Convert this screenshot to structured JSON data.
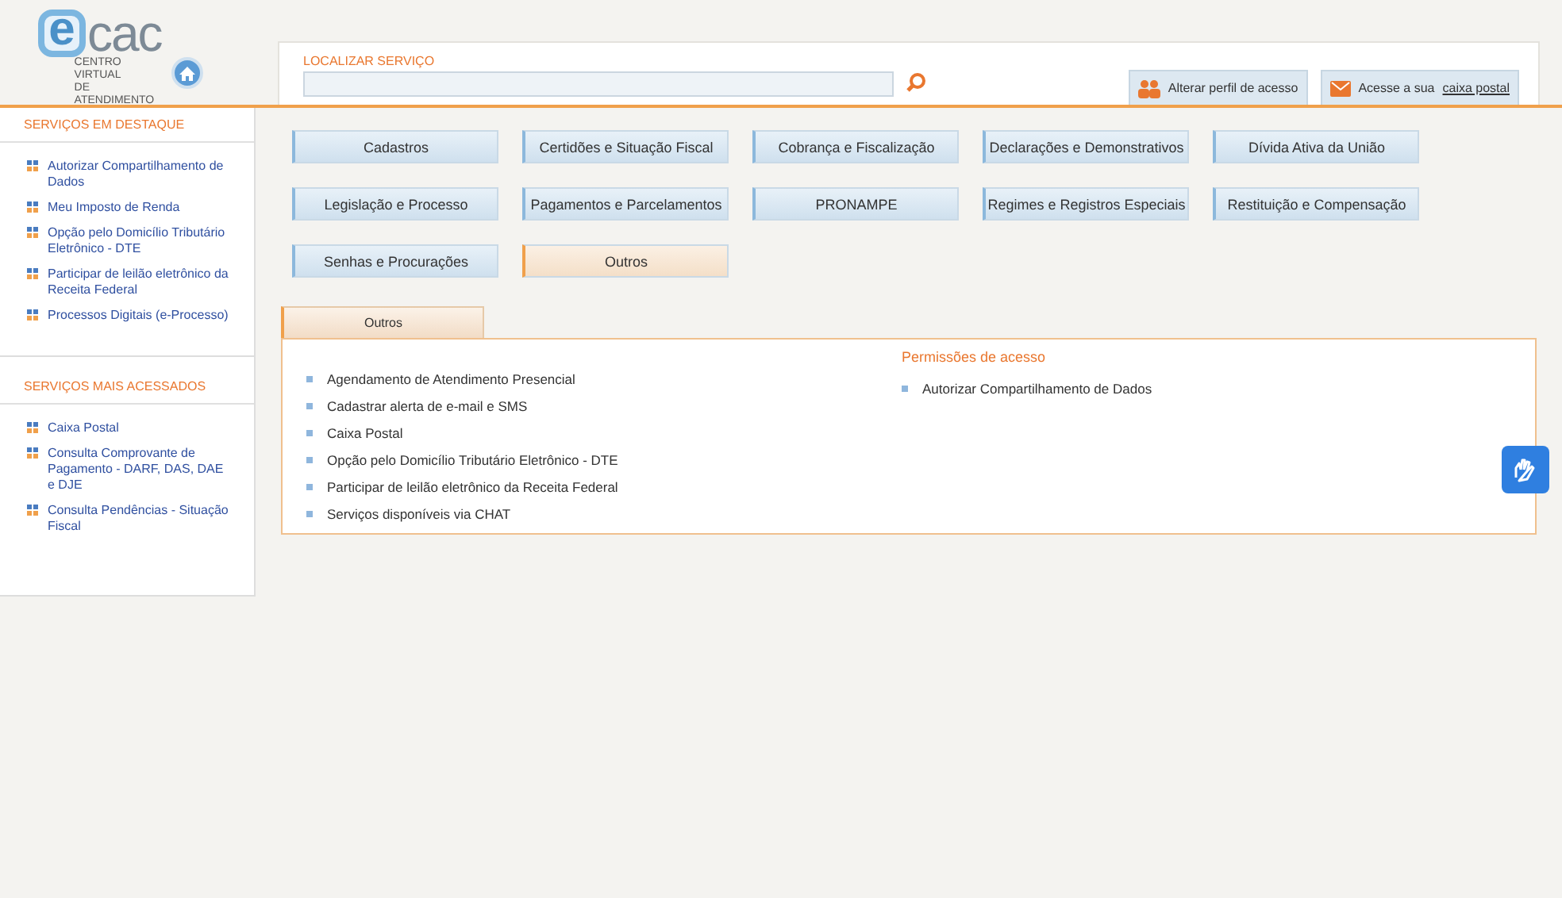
{
  "logo": {
    "mark": "e",
    "name": "cac",
    "subtitle_lines": [
      "CENTRO VIRTUAL",
      "DE ATENDIMENTO"
    ]
  },
  "search": {
    "label": "LOCALIZAR SERVIÇO"
  },
  "header_buttons": [
    {
      "kind": "profile",
      "text": "Alterar perfil de acesso"
    },
    {
      "kind": "mail",
      "text": "Acesse a sua",
      "link": "caixa postal"
    }
  ],
  "sidebar": [
    {
      "title": "SERVIÇOS EM DESTAQUE",
      "items": [
        "Autorizar Compartilhamento de Dados",
        "Meu Imposto de Renda",
        "Opção pelo Domicílio Tributário Eletrônico - DTE",
        "Participar de leilão eletrônico da Receita Federal",
        "Processos Digitais (e-Processo)"
      ]
    },
    {
      "title": "SERVIÇOS MAIS ACESSADOS",
      "items": [
        "Caixa Postal",
        "Consulta Comprovante de Pagamento - DARF, DAS, DAE e DJE",
        "Consulta Pendências - Situação Fiscal"
      ]
    }
  ],
  "categories": [
    {
      "label": "Cadastros",
      "selected": false
    },
    {
      "label": "Certidões e Situação Fiscal",
      "selected": false
    },
    {
      "label": "Cobrança e Fiscalização",
      "selected": false
    },
    {
      "label": "Declarações e Demonstrativos",
      "selected": false
    },
    {
      "label": "Dívida Ativa da União",
      "selected": false
    },
    {
      "label": "Legislação e Processo",
      "selected": false
    },
    {
      "label": "Pagamentos e Parcelamentos",
      "selected": false
    },
    {
      "label": "PRONAMPE",
      "selected": false
    },
    {
      "label": "Regimes e Registros Especiais",
      "selected": false
    },
    {
      "label": "Restituição e Compensação",
      "selected": false
    },
    {
      "label": "Senhas e Procurações",
      "selected": false
    },
    {
      "label": "Outros",
      "selected": true
    }
  ],
  "panel": {
    "tab": "Outros",
    "services": [
      "Agendamento de Atendimento Presencial",
      "Cadastrar alerta de e-mail e SMS",
      "Caixa Postal",
      "Opção pelo Domicílio Tributário Eletrônico - DTE",
      "Participar de leilão eletrônico da Receita Federal",
      "Serviços disponíveis via CHAT"
    ],
    "side_title": "Permissões de acesso",
    "side_services": [
      "Autorizar Compartilhamento de Dados"
    ]
  }
}
